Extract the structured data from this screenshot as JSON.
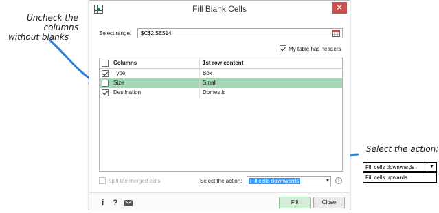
{
  "annotations": {
    "left_line1": "Uncheck the columns",
    "left_line2": "without blanks",
    "right": "Select the action:"
  },
  "dialog": {
    "title": "Fill Blank Cells",
    "close_glyph": "✕",
    "select_range_label": "Select range:",
    "select_range_value": "$C$2:$E$14",
    "headers_label": "My table has headers",
    "headers_checked": true,
    "table": {
      "col1": "Columns",
      "col2": "1st row content",
      "rows": [
        {
          "name": "Type",
          "content": "Box",
          "checked": true
        },
        {
          "name": "Size",
          "content": "Small",
          "checked": false
        },
        {
          "name": "Destination",
          "content": "Domestic",
          "checked": true
        }
      ]
    },
    "split_label": "Split the merged cells",
    "select_action_label": "Select the action:",
    "select_action_value": "Fill cells downwards",
    "fill_button": "Fill",
    "close_button": "Close",
    "footer_icons": [
      "info-icon",
      "help-icon",
      "mail-icon"
    ]
  },
  "dropdown_mock": {
    "option1": "Fill cells downwards",
    "option2": "Fill cells upwards"
  },
  "colors": {
    "selected_row": "#a4d8b7",
    "close_button": "#c75050",
    "arrow": "#2f7fd6"
  }
}
